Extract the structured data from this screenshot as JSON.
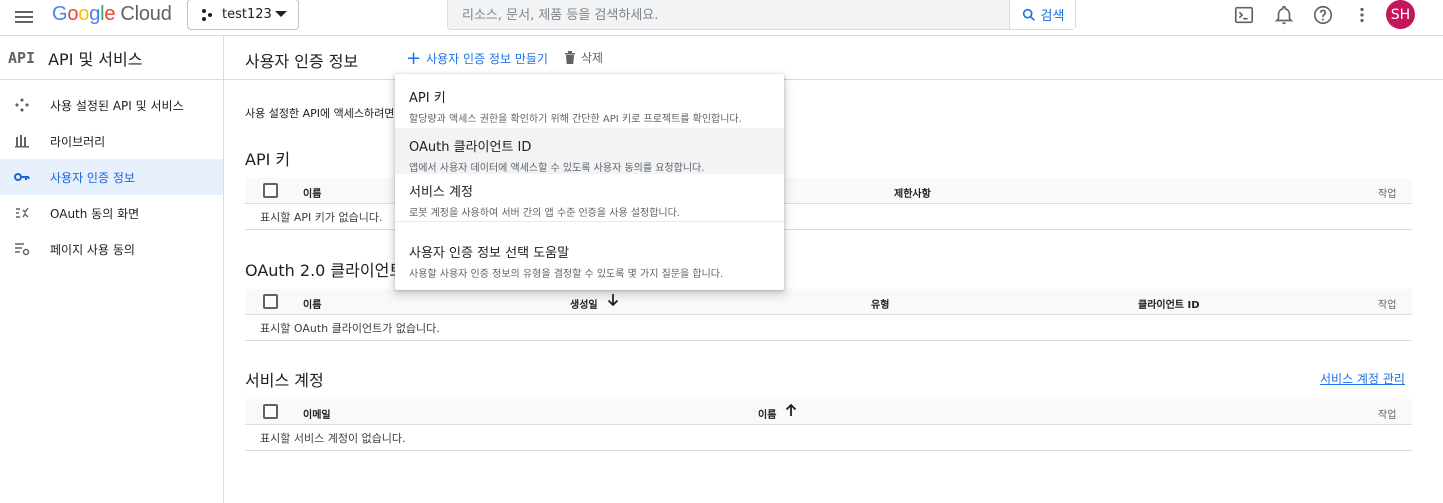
{
  "topbar": {
    "logo_google_letters": [
      "G",
      "o",
      "o",
      "g",
      "l",
      "e"
    ],
    "logo_cloud": "Cloud",
    "project_name": "test123",
    "search_placeholder": "리소스, 문서, 제품 등을 검색하세요.",
    "search_button": "검색",
    "avatar_initials": "SH",
    "avatar_color": "#c2185b",
    "icons": [
      "menu-icon",
      "project-icon",
      "terminal-icon",
      "bell-icon",
      "help-icon",
      "more-vert-icon"
    ]
  },
  "sidebar": {
    "badge": "API",
    "title": "API 및 서비스",
    "items": [
      {
        "label": "사용 설정된 API 및 서비스",
        "icon": "services-icon"
      },
      {
        "label": "라이브러리",
        "icon": "library-icon"
      },
      {
        "label": "사용자 인증 정보",
        "icon": "key-icon",
        "active": true
      },
      {
        "label": "OAuth 동의 화면",
        "icon": "consent-icon"
      },
      {
        "label": "페이지 사용 동의",
        "icon": "settings-list-icon"
      }
    ]
  },
  "main": {
    "title": "사용자 인증 정보",
    "create_label": "사용자 인증 정보 만들기",
    "delete_label": "삭제",
    "intro": "사용 설정한 API에 액세스하려면",
    "api_keys": {
      "title": "API 키",
      "columns": {
        "name": "이름",
        "restrictions": "제한사항",
        "actions": "작업"
      },
      "empty": "표시할 API 키가 없습니다."
    },
    "oauth": {
      "title": "OAuth 2.0 클라이언트",
      "columns": {
        "name": "이름",
        "created": "생성일",
        "type": "유형",
        "client_id": "클라이언트 ID",
        "actions": "작업"
      },
      "empty": "표시할 OAuth 클라이언트가 없습니다."
    },
    "service_accounts": {
      "title": "서비스 계정",
      "manage_link": "서비스 계정 관리",
      "columns": {
        "email": "이메일",
        "name": "이름",
        "actions": "작업"
      },
      "empty": "표시할 서비스 계정이 없습니다."
    }
  },
  "menu": {
    "items": [
      {
        "title": "API 키",
        "desc": "할당량과 액세스 권한을 확인하기 위해 간단한 API 키로 프로젝트를 확인합니다."
      },
      {
        "title": "OAuth 클라이언트 ID",
        "desc": "앱에서 사용자 데이터에 액세스할 수 있도록 사용자 동의를 요청합니다.",
        "hovered": true
      },
      {
        "title": "서비스 계정",
        "desc": "로봇 계정을 사용하여 서버 간의 앱 수준 인증을 사용 설정합니다."
      },
      {
        "title": "사용자 인증 정보 선택 도움말",
        "desc": "사용할 사용자 인증 정보의 유형을 결정할 수 있도록 몇 가지 질문을 합니다."
      }
    ]
  },
  "colors": {
    "accent": "#1a73e8",
    "active_bg": "#e8f0fe",
    "border": "#dadce0"
  }
}
